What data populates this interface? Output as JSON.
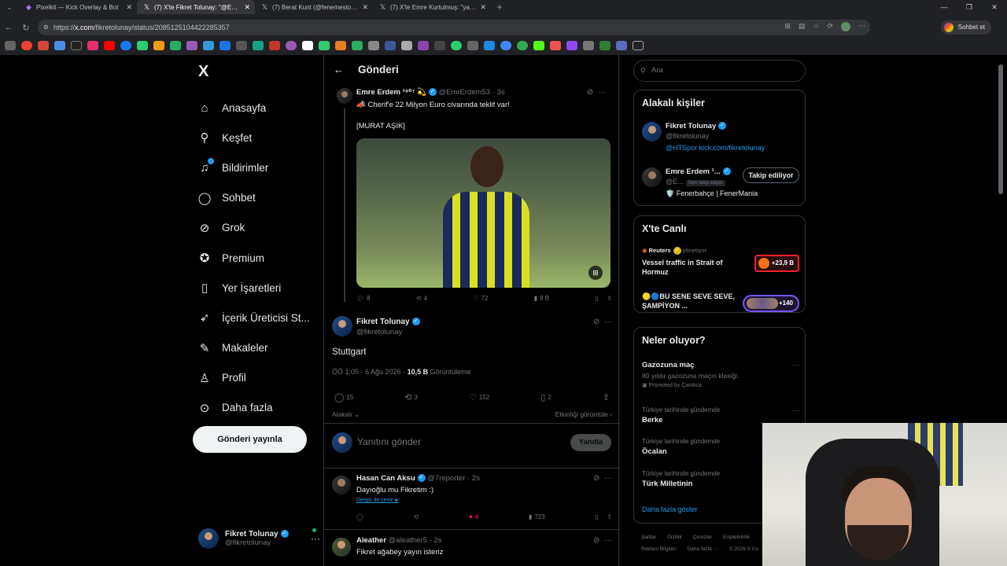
{
  "browser": {
    "tabs": [
      {
        "label": "Pixelkit — Kick Overlay & Bot",
        "icon": "pixelkit-icon",
        "active": false
      },
      {
        "label": "(7) X'te Fikret Tolunay: \"@EmrErdem53",
        "icon": "x-icon",
        "active": true
      },
      {
        "label": "(7) Berat Kunt (@fenemesto) / X",
        "icon": "x-icon",
        "active": false
      },
      {
        "label": "(7) X'te Emre Kurtulmuş: \"yabancı",
        "icon": "x-icon",
        "active": false
      }
    ],
    "url_prefix": "https://",
    "url_domain": "x.com",
    "url_path": "/fikretolunay/status/2085125104422285357",
    "chat_button": "Sohbet et"
  },
  "sidebar": {
    "logo": "X",
    "items": [
      {
        "label": "Anasayfa",
        "icon": "home-icon",
        "glyph": "⌂"
      },
      {
        "label": "Keşfet",
        "icon": "search-icon",
        "glyph": "⌕"
      },
      {
        "label": "Bildirimler",
        "icon": "bell-icon",
        "glyph": "🔔︎"
      },
      {
        "label": "Sohbet",
        "icon": "chat-icon",
        "glyph": "◯"
      },
      {
        "label": "Grok",
        "icon": "grok-icon",
        "glyph": "⊘"
      },
      {
        "label": "Premium",
        "icon": "premium-icon",
        "glyph": "✓"
      },
      {
        "label": "Yer İşaretleri",
        "icon": "bookmark-icon",
        "glyph": "▯"
      },
      {
        "label": "İçerik Üreticisi St...",
        "icon": "rocket-icon",
        "glyph": "➶"
      },
      {
        "label": "Makaleler",
        "icon": "article-icon",
        "glyph": "✎"
      },
      {
        "label": "Profil",
        "icon": "profile-icon",
        "glyph": "♙"
      },
      {
        "label": "Daha fazla",
        "icon": "more-icon",
        "glyph": "⋯"
      }
    ],
    "post_button": "Gönderi yayınla",
    "account": {
      "name": "Fikret Tolunay",
      "handle": "@fikretolunay"
    }
  },
  "center": {
    "title": "Gönderi",
    "quoted": {
      "name": "Emre Erdem ¹⁹⁰⁷ 💫",
      "handle": "@EmrErdem53",
      "time": "· 3s",
      "text1": "📣 Cherif'e 22 Milyon Euro civarında teklif var!",
      "text2": "[MURAT AŞIK]",
      "replies": "8",
      "reposts": "4",
      "likes": "72",
      "views": "8 B"
    },
    "main": {
      "name": "Fikret Tolunay",
      "handle": "@fikretolunay",
      "text": "Stuttgart",
      "time": "ÖÖ 1:05 · 6 Ağu 2026 ·",
      "views_count": "10,5 B",
      "views_label": "Görüntüleme",
      "replies": "15",
      "reposts": "3",
      "likes": "152",
      "bookmarks": "2",
      "related": "Alakalı",
      "activity": "Etkinliği görüntüle"
    },
    "reply_placeholder": "Yanıtını gönder",
    "reply_button": "Yanıtla",
    "replies": [
      {
        "name": "Hasan Can Aksu",
        "handle": "@7reporter",
        "time": "· 2s",
        "text": "Dayıoğlu mu Fikretim :)",
        "link": "DeepL ile çevir",
        "replies": "",
        "reposts": "",
        "likes": "4",
        "views": "723"
      },
      {
        "name": "Aleather",
        "handle": "@aleather5",
        "time": "· 2s",
        "text": "Fikret ağabey yayın isteriz"
      }
    ]
  },
  "right": {
    "search_placeholder": "Ara",
    "related_title": "Alakalı kişiler",
    "people": [
      {
        "name": "Fikret Tolunay",
        "handle": "@fikretolunay",
        "bio_link": "@HTSpor kick.com/fikretolunay"
      },
      {
        "name": "Emre Erdem ¹...",
        "handle": "@E...",
        "follows_you": "Seni takip ediyor",
        "bio": "🛡️ Fenerbahçe | FenerMania",
        "button": "Takip ediliyor"
      }
    ],
    "live_title": "X'te Canlı",
    "live": [
      {
        "source": "Reuters",
        "role": "yönetiyor",
        "text": "Vessel traffic in Strait of Hormuz",
        "badge": "+23,9 B"
      },
      {
        "text": "🟡🔵BU SENE SEVE SEVE, ŞAMPİYON ...",
        "badge": "+140"
      }
    ],
    "trends_title": "Neler oluyor?",
    "trends": [
      {
        "name": "Gazozuna maç",
        "sub": "80 yıldır gazozuna maçın klasiği.",
        "promo": "Promoted by Çamlıca"
      },
      {
        "meta": "Türkiye tarihinde gündemde",
        "name": "Berke"
      },
      {
        "meta": "Türkiye tarihinde gündemde",
        "name": "Öcalan"
      },
      {
        "meta": "Türkiye tarihinde gündemde",
        "name": "Türk Milletinin"
      }
    ],
    "show_more": "Daha fazla göster",
    "footer": [
      "Şartlar",
      "Gizlilik",
      "Çerezler",
      "Erişilebilirlik",
      "Reklam Bilgileri",
      "Daha fazla ···",
      "© 2026 X Co"
    ]
  },
  "colors": {
    "accent": "#1d9bf0",
    "like": "#f91880",
    "background": "#000000",
    "border": "#2f3336"
  }
}
